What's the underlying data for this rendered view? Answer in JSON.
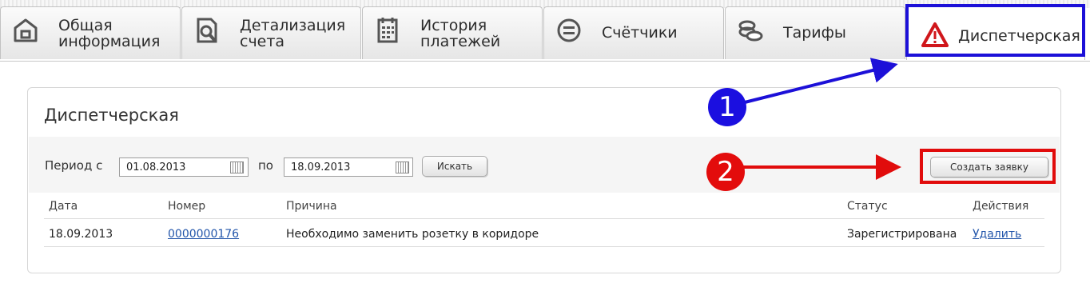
{
  "tabs": [
    {
      "label": "Общая\nинформация",
      "icon": "home-icon"
    },
    {
      "label": "Детализация\nсчета",
      "icon": "document-search-icon"
    },
    {
      "label": "История\nплатежей",
      "icon": "calendar-icon"
    },
    {
      "label": "Счётчики",
      "icon": "meter-icon"
    },
    {
      "label": "Тарифы",
      "icon": "coins-icon"
    },
    {
      "label": "Диспетчерская",
      "icon": "warning-icon",
      "active": true
    }
  ],
  "panel": {
    "title": "Диспетчерская",
    "filter": {
      "period_from_label": "Период с",
      "from_value": "01.08.2013",
      "to_label": "по",
      "to_value": "18.09.2013",
      "search_button": "Искать",
      "create_button": "Создать заявку"
    },
    "table": {
      "headers": [
        "Дата",
        "Номер",
        "Причина",
        "Статус",
        "Действия"
      ],
      "rows": [
        {
          "date": "18.09.2013",
          "number": "0000000176",
          "reason": "Необходимо заменить розетку в коридоре",
          "status": "Зарегистрирована",
          "action": "Удалить"
        }
      ]
    }
  },
  "annotations": {
    "marker1": "1",
    "marker2": "2",
    "tab_highlight_color": "#1c10d8",
    "button_highlight_color": "#e10c0c"
  },
  "colors": {
    "warning_red": "#d0161b",
    "link": "#2255aa"
  }
}
